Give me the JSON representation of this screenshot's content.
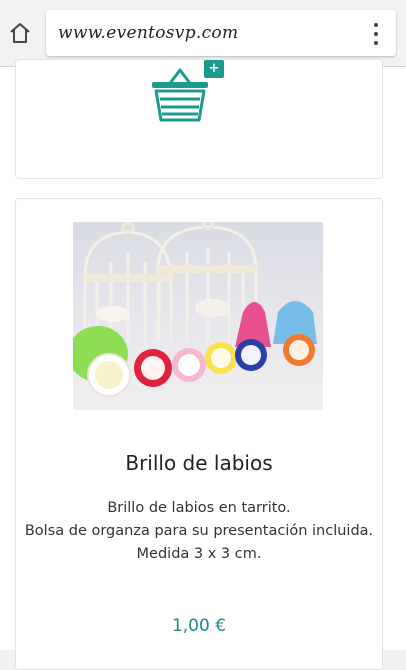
{
  "browser": {
    "url": "www.eventosvp.com"
  },
  "cart": {
    "badge": "+"
  },
  "product": {
    "title": "Brillo de labios",
    "description": [
      "Brillo de labios en tarrito.",
      "Bolsa de organza para su presentación incluida.",
      "Medida 3 x 3 cm."
    ],
    "price": "1,00 €"
  },
  "colors": {
    "accent": "#1d9a8e",
    "price": "#1d8b80"
  }
}
